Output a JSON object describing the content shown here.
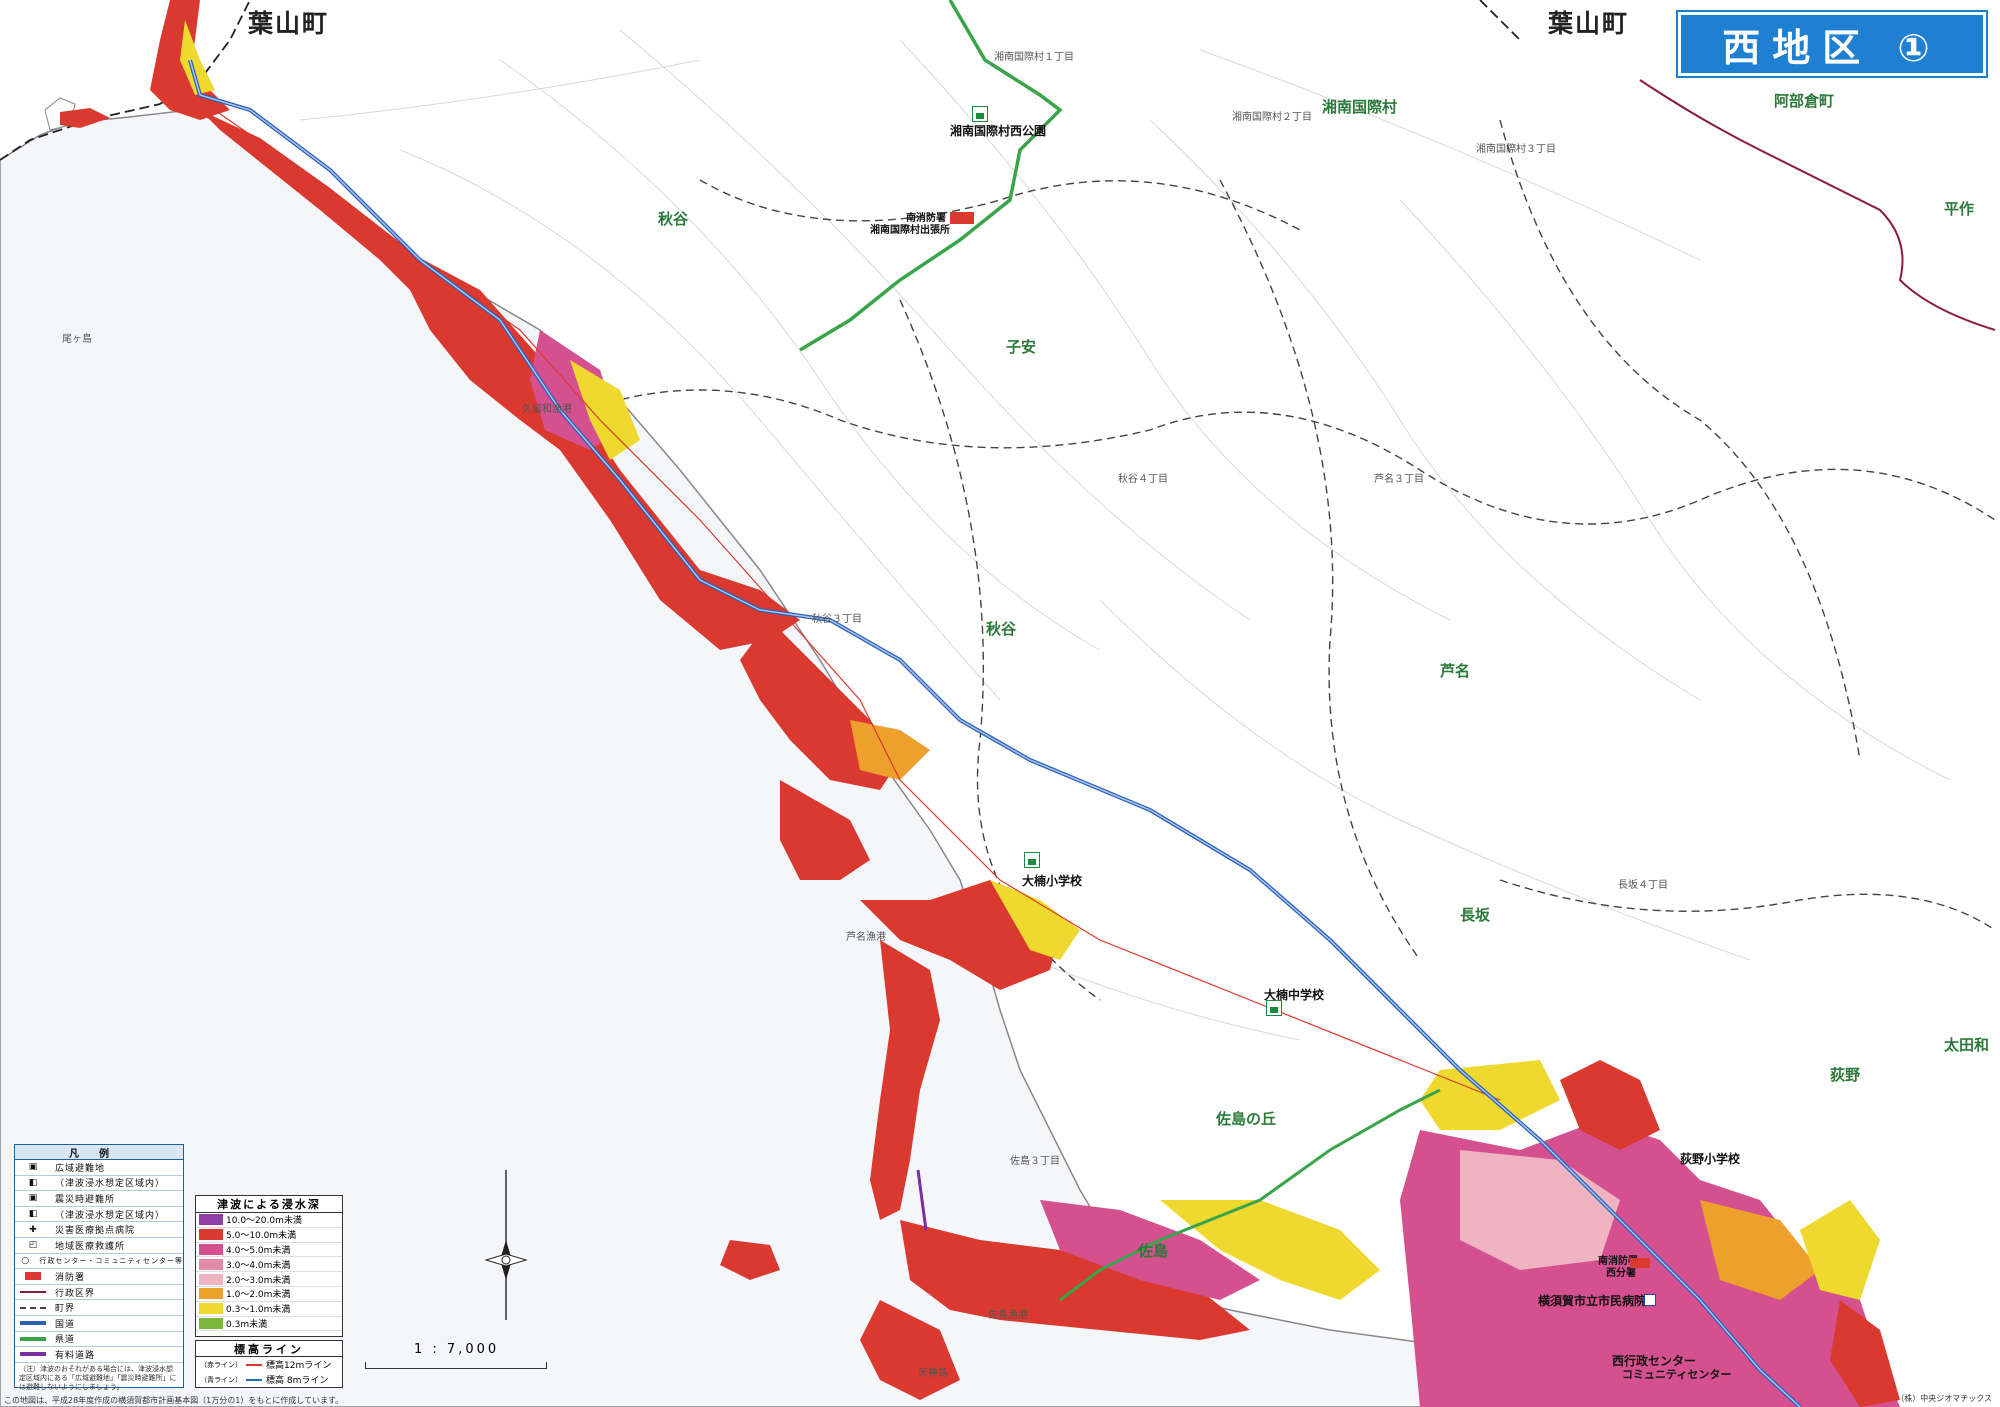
{
  "map": {
    "title": "西地区 ①",
    "towns": {
      "hayama_left": "葉山町",
      "hayama_right": "葉山町"
    },
    "places": {
      "akiya_north": "秋谷",
      "akiya_central": "秋谷",
      "koyasu": "子安",
      "shonan_kokusai": "湘南国際村",
      "abekura": "阿部倉町",
      "heisaku": "平作",
      "ashina": "芦名",
      "nagasaka": "長坂",
      "ogino": "荻野",
      "otawa": "太田和",
      "sajima_oka": "佐島の丘",
      "sajima": "佐島"
    },
    "small_labels": {
      "kugiwa_port": "久留和漁港",
      "ashina_port": "芦名漁港",
      "sajima_port": "佐島漁港",
      "akiya_4": "秋谷４丁目",
      "akiya_3": "秋谷３丁目",
      "ashina_3": "芦名３丁目",
      "nagasaka_4": "長坂４丁目",
      "sajima_3": "佐島３丁目",
      "tenjin": "天神島",
      "ozaki": "尾ヶ島",
      "kokusai_1": "湘南国際村１丁目",
      "kokusai_2": "湘南国際村２丁目",
      "kokusai_3": "湘南国際村３丁目"
    },
    "facilities": {
      "park": "湘南国際村西公園",
      "fire_branch_1": "南消防署",
      "fire_branch_2": "湘南国際村出張所",
      "ogusu_elem": "大楠小学校",
      "ogusu_junior": "大楠中学校",
      "ogino_elem": "荻野小学校",
      "fire_west_1": "南消防署",
      "fire_west_2": "西分署",
      "hospital": "横須賀市立市民病院",
      "admin_1": "西行政センター",
      "admin_2": "コミュニティセンター"
    }
  },
  "legend": {
    "heading": "凡例",
    "items": [
      "広域避難地",
      "（津波浸水想定区域内）",
      "震災時避難所",
      "（津波浸水想定区域内）",
      "災害医療拠点病院",
      "地域医療救護所",
      "行政センター・コミュニティセンター等",
      "消防署",
      "行政区界",
      "町界",
      "国道",
      "県道",
      "有料道路"
    ],
    "note": "（注）津波のおそれがある場合には、津波浸水想定区域内にある「広域避難地」「震災時避難所」には避難しないようにしましょう。"
  },
  "depth_legend": {
    "heading": "津波による浸水深",
    "levels": [
      {
        "label": "10.0～20.0m未満",
        "color": "#8e3fa6"
      },
      {
        "label": "5.0～10.0m未満",
        "color": "#d9392f"
      },
      {
        "label": "4.0～5.0m未満",
        "color": "#d4508f"
      },
      {
        "label": "3.0～4.0m未満",
        "color": "#e58aa6"
      },
      {
        "label": "2.0～3.0m未満",
        "color": "#efb3c2"
      },
      {
        "label": "1.0～2.0m未満",
        "color": "#eea02c"
      },
      {
        "label": "0.3～1.0m未満",
        "color": "#efd92e"
      },
      {
        "label": "0.3m未満",
        "color": "#7bb83a"
      }
    ]
  },
  "elevation_legend": {
    "heading": "標高ライン",
    "lines": [
      {
        "tag": "（赤ライン）",
        "label": "標高12mライン",
        "color": "#d9392f"
      },
      {
        "tag": "（青ライン）",
        "label": "標高 8mライン",
        "color": "#1f6fc0"
      }
    ]
  },
  "scale": {
    "label": "1 : 7,000"
  },
  "footer": {
    "left": "この地図は、平成28年度作成の横須賀都市計画基本図（1万分の1）をもとに作成しています。",
    "right": "（株）中央ジオマチックス"
  }
}
